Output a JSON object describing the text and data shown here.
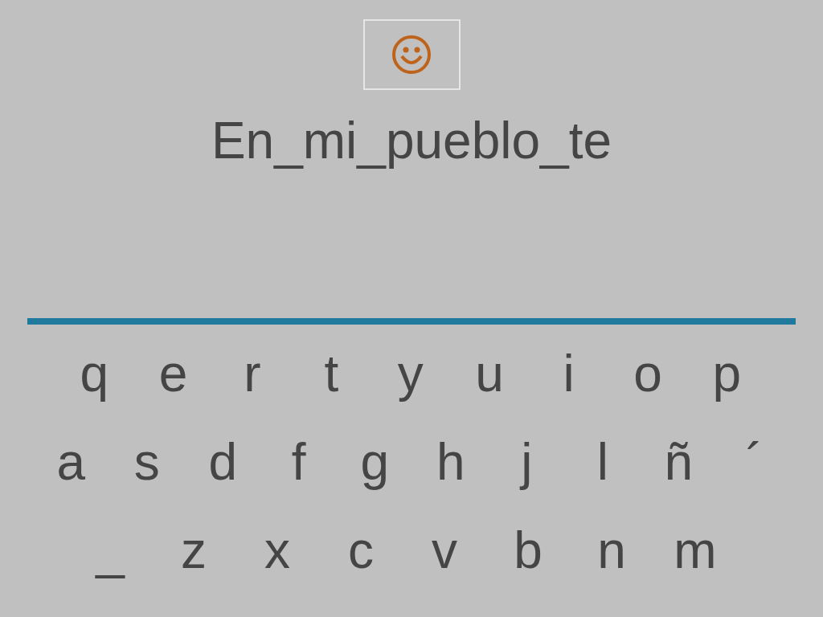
{
  "phrase": "En_mi_pueblo_te",
  "keyboard": {
    "rows": [
      [
        "q",
        "e",
        "r",
        "t",
        "y",
        "u",
        "i",
        "o",
        "p"
      ],
      [
        "a",
        "s",
        "d",
        "f",
        "g",
        "h",
        "j",
        "l",
        "ñ",
        "´"
      ],
      [
        "_",
        "z",
        "x",
        "c",
        "v",
        "b",
        "n",
        "m"
      ]
    ]
  }
}
